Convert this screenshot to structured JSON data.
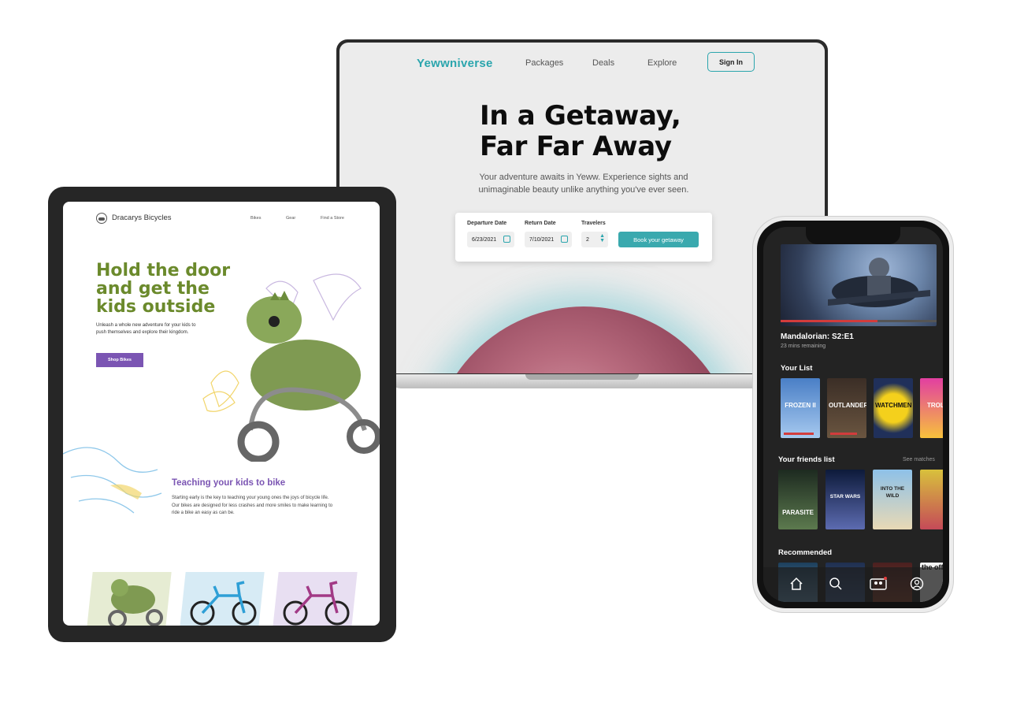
{
  "laptop": {
    "logo": "Yewwniverse",
    "nav": [
      "Packages",
      "Deals",
      "Explore"
    ],
    "sign_in": "Sign In",
    "hero_line1": "In a Getaway,",
    "hero_line2": "Far Far Away",
    "subtitle": "Your adventure awaits in Yeww. Experience sights and unimaginable beauty unlike anything you've ever seen.",
    "form": {
      "departure_label": "Departure Date",
      "departure_value": "6/23/2021",
      "return_label": "Return Date",
      "return_value": "7/10/2021",
      "travelers_label": "Travelers",
      "travelers_value": "2",
      "book_button": "Book your getaway"
    },
    "accent": "#2aa5ad"
  },
  "tablet": {
    "brand": "Dracarys Bicycles",
    "nav": [
      "Bikes",
      "Gear",
      "Find a Store"
    ],
    "hero_l1": "Hold the door",
    "hero_l2": "and get the",
    "hero_l3": "kids outside",
    "hero_text": "Unleash a whole new adventure for your kids to push themselves and explore their kingdom.",
    "shop_button": "Shop Bikes",
    "section_title": "Teaching your kids to bike",
    "section_text": "Starting early is the key to teaching your young ones the joys of bicycle life. Our bikes are designed for less crashes and more smiles to make learning to ride a bike an easy as can be.",
    "accent_green": "#6b8a2c",
    "accent_purple": "#7b55b3"
  },
  "phone": {
    "now_playing_title": "Mandalorian: S2:E1",
    "now_playing_sub": "23 mins remaining",
    "now_playing_progress": 0.62,
    "your_list_title": "Your List",
    "your_list": [
      {
        "title": "FROZEN II",
        "progress": 0.9
      },
      {
        "title": "OUTLANDER",
        "progress": 0.8
      },
      {
        "title": "WATCHMEN",
        "progress": 0
      },
      {
        "title": "TROLLS",
        "progress": 0
      }
    ],
    "friends_title": "Your friends list",
    "friends_link": "See matches",
    "friends_list": [
      "PARASITE",
      "STAR WARS",
      "INTO THE WILD",
      ""
    ],
    "recommended_title": "Recommended",
    "recommended_partial": "the off",
    "tabbar": [
      "home-icon",
      "search-icon",
      "profiles-icon",
      "account-icon"
    ]
  }
}
